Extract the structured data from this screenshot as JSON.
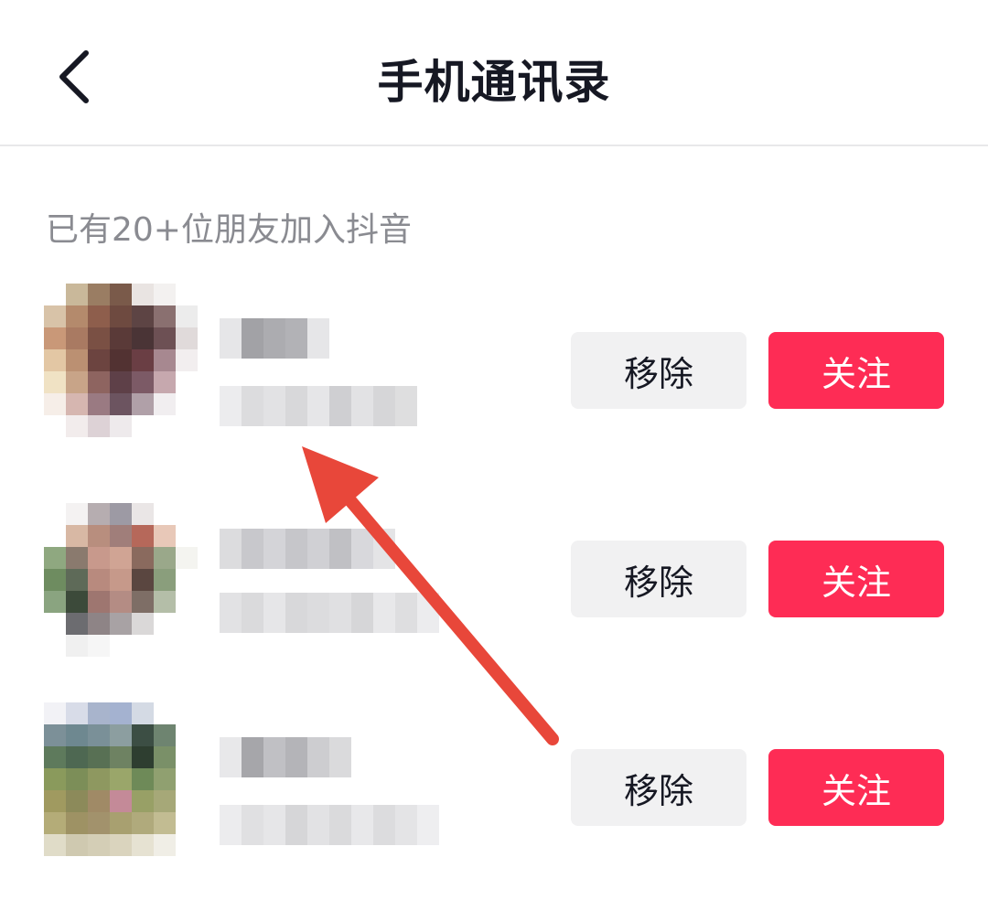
{
  "header": {
    "title": "手机通讯录",
    "back_icon": "chevron-left-icon"
  },
  "subtitle": "已有20+位朋友加入抖音",
  "contacts": [
    {
      "remove_label": "移除",
      "follow_label": "关注"
    },
    {
      "remove_label": "移除",
      "follow_label": "关注"
    },
    {
      "remove_label": "移除",
      "follow_label": "关注"
    }
  ],
  "colors": {
    "accent": "#fe2c55",
    "annotation_arrow": "#e8473a",
    "remove_bg": "#f1f1f2",
    "title": "#161823",
    "subtitle": "#8a8b91"
  }
}
